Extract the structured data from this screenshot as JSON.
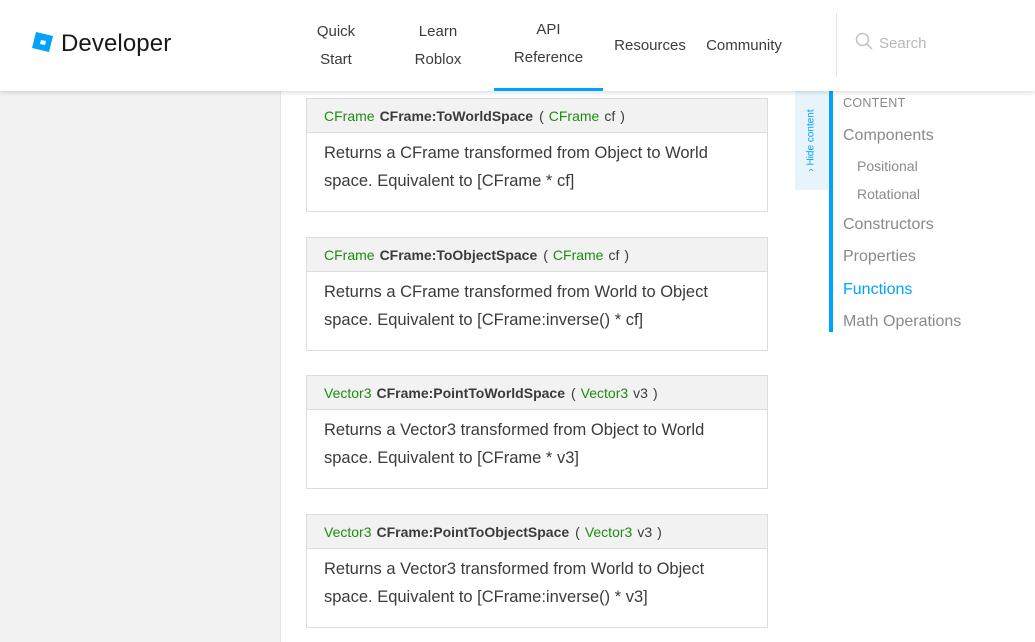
{
  "header": {
    "logo_text": "Developer",
    "nav": [
      {
        "line1": "Quick",
        "line2": "Start"
      },
      {
        "line1": "Learn",
        "line2": "Roblox"
      },
      {
        "line1": "API",
        "line2": "Reference"
      },
      {
        "line1": "Resources",
        "line2": ""
      },
      {
        "line1": "Community",
        "line2": ""
      }
    ],
    "search_placeholder": "Search"
  },
  "functions": [
    {
      "return_type": "CFrame",
      "name": "CFrame:ToWorldSpace",
      "open": "(",
      "param_type": "CFrame",
      "param_name": "cf",
      "close": ")",
      "description": "Returns a CFrame transformed from Object to World space. Equivalent to [CFrame * cf]"
    },
    {
      "return_type": "CFrame",
      "name": "CFrame:ToObjectSpace",
      "open": "(",
      "param_type": "CFrame",
      "param_name": "cf",
      "close": ")",
      "description": "Returns a CFrame transformed from World to Object space. Equivalent to [CFrame:inverse() * cf]"
    },
    {
      "return_type": "Vector3",
      "name": "CFrame:PointToWorldSpace",
      "open": "(",
      "param_type": "Vector3",
      "param_name": "v3",
      "close": ")",
      "description": "Returns a Vector3 transformed from Object to World space. Equivalent to [CFrame * v3]"
    },
    {
      "return_type": "Vector3",
      "name": "CFrame:PointToObjectSpace",
      "open": "(",
      "param_type": "Vector3",
      "param_name": "v3",
      "close": ")",
      "description": "Returns a Vector3 transformed from World to Object space. Equivalent to [CFrame:inverse() * v3]"
    }
  ],
  "sidebar_toggle": {
    "label": "Hide content"
  },
  "toc": {
    "title": "CONTENT",
    "items": [
      "Components",
      "Positional",
      "Rotational",
      "Constructors",
      "Properties",
      "Functions",
      "Math Operations"
    ],
    "active": "Functions"
  },
  "colors": {
    "accent": "#00a2ff",
    "type": "#1c8d0e",
    "text": "#393b3d",
    "muted": "#8a8a8a"
  },
  "icons": {
    "logo": "roblox-studio-logo-icon",
    "search": "search-icon",
    "toggle": "chevron-right-icon"
  }
}
